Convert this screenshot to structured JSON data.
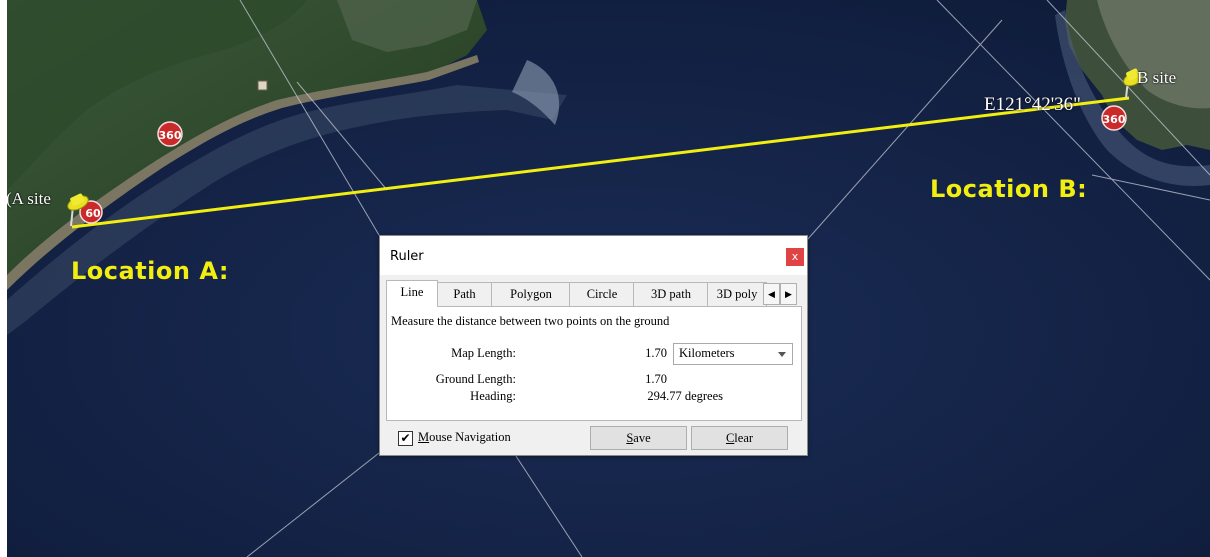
{
  "map": {
    "location_a_label": "Location A:",
    "location_b_label": "Location B:",
    "pin_a_label": "A site",
    "pin_a_prefix": "(",
    "pin_b_label": "B site",
    "coordinate_label": "E121°42'36\"",
    "marker_360": "360",
    "marker_60": "60",
    "measure_line_color": "#f2ee10",
    "pin_color": "#e8e020"
  },
  "ruler": {
    "title": "Ruler",
    "close_glyph": "x",
    "tabs": [
      {
        "label": "Line",
        "active": true
      },
      {
        "label": "Path",
        "active": false
      },
      {
        "label": "Polygon",
        "active": false
      },
      {
        "label": "Circle",
        "active": false
      },
      {
        "label": "3D path",
        "active": false
      },
      {
        "label": "3D poly",
        "active": false
      }
    ],
    "tab_scroll_left": "◀",
    "tab_scroll_right": "▶",
    "description": "Measure the distance between two points on the ground",
    "map_length_label": "Map Length:",
    "map_length_value": "1.70",
    "unit": "Kilometers",
    "ground_length_label": "Ground Length:",
    "ground_length_value": "1.70",
    "heading_label": "Heading:",
    "heading_value": "294.77 degrees",
    "mouse_navigation_checked": true,
    "mouse_navigation_checkmark": "✔",
    "mouse_navigation_label": "Mouse Navigation",
    "save_label": "Save",
    "clear_label": "Clear"
  }
}
